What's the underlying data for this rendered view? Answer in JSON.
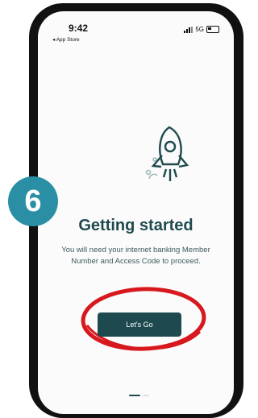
{
  "status_bar": {
    "time": "9:42",
    "back_label": "◂ App Store",
    "network": "5G"
  },
  "step_badge": "6",
  "content": {
    "title": "Getting started",
    "subtitle": "You will need your internet banking Member Number and Access Code to proceed.",
    "cta_label": "Let's Go"
  },
  "pager": {
    "total": 2,
    "active_index": 0
  },
  "colors": {
    "accent": "#1e4a4f",
    "badge": "#2a8fa4",
    "annotation": "#d7191f"
  }
}
